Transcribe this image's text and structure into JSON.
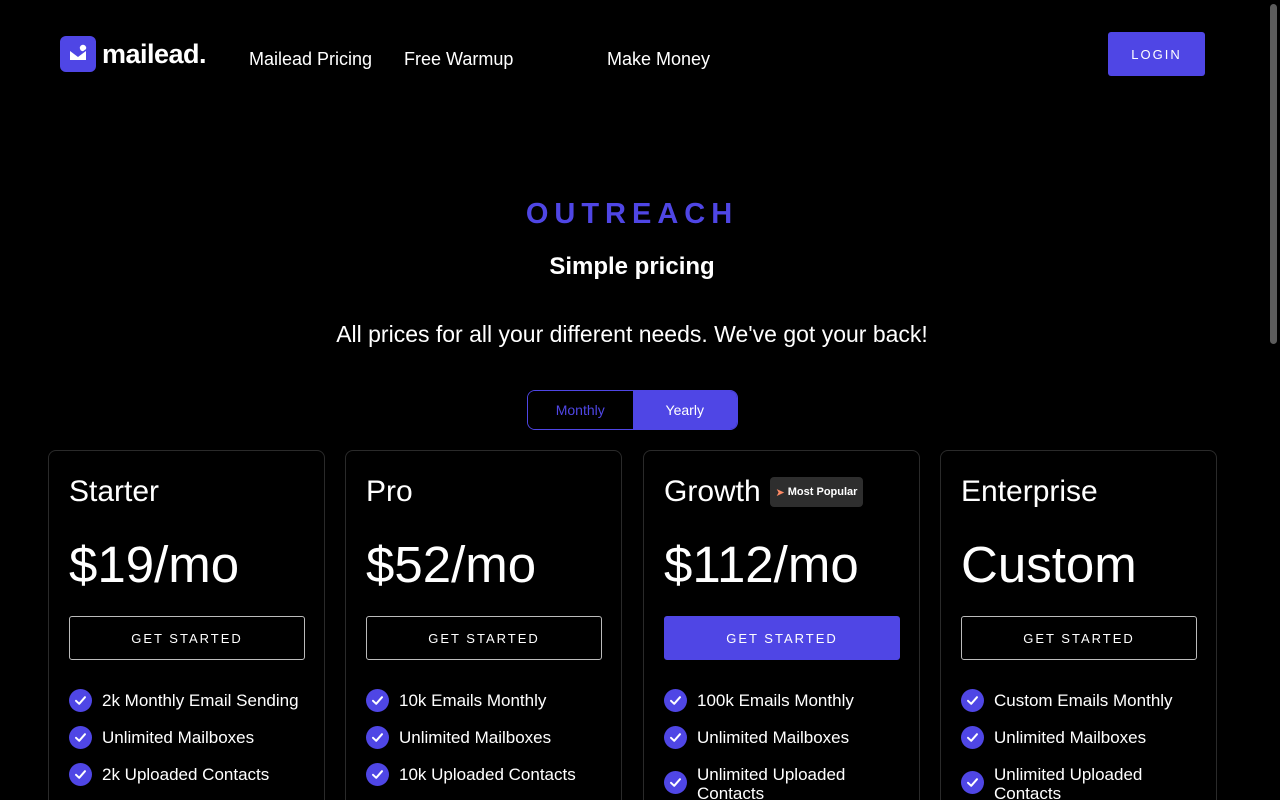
{
  "header": {
    "logo_text": "mailead.",
    "nav": [
      "Mailead Pricing",
      "Free Warmup",
      "Make Money"
    ],
    "login_label": "LOGIN"
  },
  "hero": {
    "eyebrow": "OUTREACH",
    "title": "Simple pricing",
    "subtitle": "All prices for all your different needs. We've got your back!"
  },
  "billing_toggle": {
    "options": [
      "Monthly",
      "Yearly"
    ],
    "selected": "Yearly"
  },
  "plans": [
    {
      "name": "Starter",
      "price": "$19/mo",
      "cta": "GET STARTED",
      "features": [
        "2k Monthly Email Sending",
        "Unlimited Mailboxes",
        "2k Uploaded Contacts"
      ]
    },
    {
      "name": "Pro",
      "price": "$52/mo",
      "cta": "GET STARTED",
      "features": [
        "10k Emails Monthly",
        "Unlimited Mailboxes",
        "10k Uploaded Contacts"
      ]
    },
    {
      "name": "Growth",
      "badge": "Most Popular",
      "price": "$112/mo",
      "cta": "GET STARTED",
      "features": [
        "100k Emails Monthly",
        "Unlimited Mailboxes",
        "Unlimited Uploaded Contacts"
      ]
    },
    {
      "name": "Enterprise",
      "price": "Custom",
      "cta": "GET STARTED",
      "features": [
        "Custom Emails Monthly",
        "Unlimited Mailboxes",
        "Unlimited Uploaded Contacts"
      ]
    }
  ],
  "colors": {
    "accent": "#4f46e5",
    "background": "#000000",
    "card_border": "#2a2a2a",
    "badge_bg": "#2e2e2e"
  },
  "icons": {
    "logo": "mail-heart-icon",
    "feature": "check-circle-icon",
    "badge": "rocket-icon"
  }
}
